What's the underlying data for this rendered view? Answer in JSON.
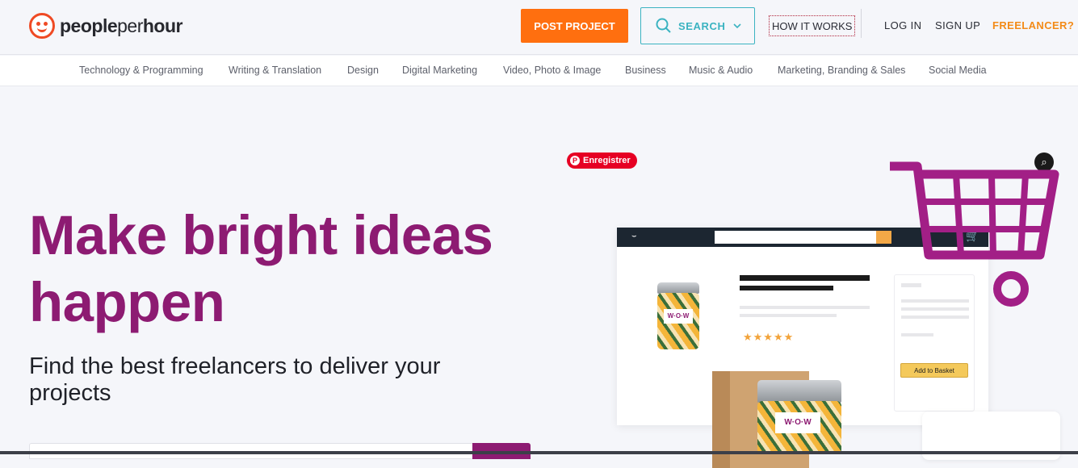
{
  "brand": {
    "logo_text_bold": "people",
    "logo_text_light": "per",
    "logo_text_bold2": "hour"
  },
  "header": {
    "post_project": "POST PROJECT",
    "search": "SEARCH",
    "how_it_works": "HOW IT WORKS",
    "log_in": "LOG IN",
    "sign_up": "SIGN UP",
    "freelancer": "FREELANCER?"
  },
  "categories": [
    "Technology & Programming",
    "Writing & Translation",
    "Design",
    "Digital Marketing",
    "Video, Photo & Image",
    "Business",
    "Music & Audio",
    "Marketing, Branding & Sales",
    "Social Media"
  ],
  "hero": {
    "title_line1": "Make bright ideas",
    "title_line2": "happen",
    "subtitle": "Find the best freelancers to deliver your projects"
  },
  "pinterest": {
    "label": "Enregistrer",
    "icon": "pinterest-icon"
  },
  "illustration": {
    "add_to_basket": "Add to Basket",
    "jar_label": "W·O·W",
    "rating_stars": "★★★★★"
  },
  "colors": {
    "accent": "#8d1b72",
    "post": "#ff6f0f",
    "search": "#3bb3c1",
    "freelancer": "#f38b18"
  }
}
